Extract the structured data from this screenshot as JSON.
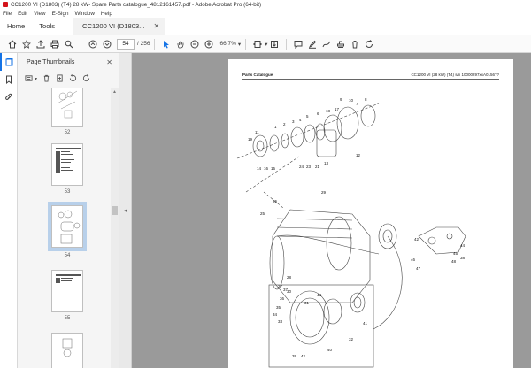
{
  "window": {
    "title": "CC1200 VI (D1803) (T4) 28 kW- Spare Parts catalogue_4812161457.pdf - Adobe Acrobat Pro (64-bit)"
  },
  "menu": [
    "File",
    "Edit",
    "View",
    "E-Sign",
    "Window",
    "Help"
  ],
  "tabs": {
    "home": "Home",
    "tools": "Tools",
    "document": "CC1200 VI (D1803..."
  },
  "toolbar": {
    "current_page": "54",
    "page_total": "/ 256",
    "zoom": "66.7%"
  },
  "panel": {
    "title": "Page Thumbnails",
    "thumbnails": [
      {
        "label": "52"
      },
      {
        "label": "53"
      },
      {
        "label": "54",
        "selected": true
      },
      {
        "label": "55"
      },
      {
        "label": ""
      }
    ]
  },
  "document_page": {
    "header_left": "Parts Catalogue",
    "header_right": "CC1200 VI (28 kW) (T4) s/n 10000297xxA0156??",
    "callouts": [
      "19",
      "11",
      "1",
      "2",
      "3",
      "4",
      "5",
      "6",
      "18",
      "17",
      "7",
      "8",
      "14",
      "16",
      "15",
      "24",
      "23",
      "21",
      "13",
      "12",
      "10",
      "9",
      "29",
      "25",
      "26",
      "27",
      "28",
      "30",
      "31",
      "43",
      "42",
      "44",
      "45",
      "46",
      "47",
      "48",
      "38",
      "37",
      "36",
      "35",
      "34",
      "33",
      "32",
      "41",
      "42",
      "39",
      "40"
    ]
  }
}
